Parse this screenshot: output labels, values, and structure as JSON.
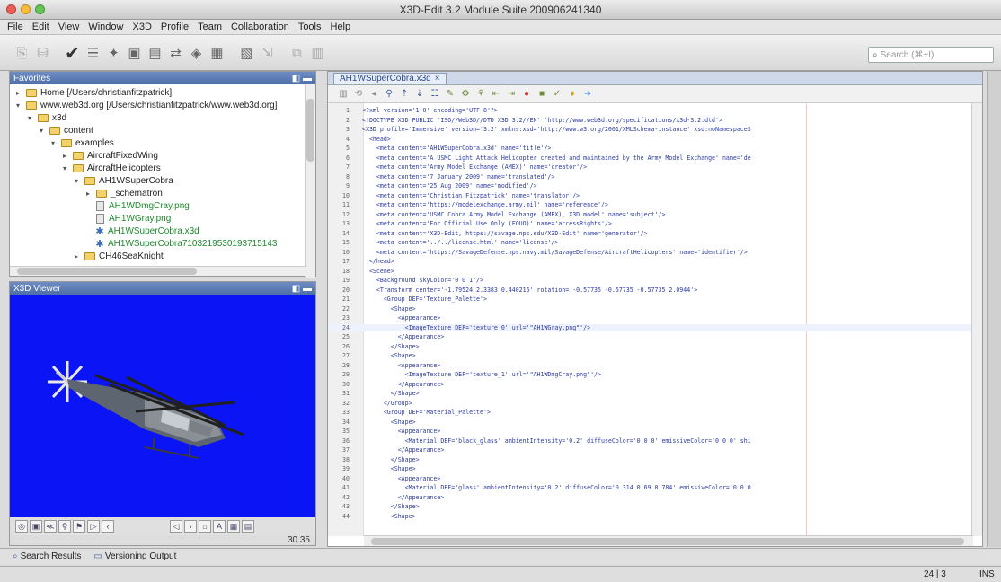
{
  "window": {
    "title": "X3D-Edit 3.2 Module Suite 200906241340"
  },
  "menu": [
    "File",
    "Edit",
    "View",
    "Window",
    "X3D",
    "Profile",
    "Team",
    "Collaboration",
    "Tools",
    "Help"
  ],
  "search": {
    "placeholder": "Search (⌘+I)"
  },
  "favorites": {
    "title": "Favorites",
    "items": [
      {
        "label": "Home [/Users/christianfitzpatrick]",
        "level": 0,
        "kind": "folder",
        "toggle": "+"
      },
      {
        "label": "www.web3d.org [/Users/christianfitzpatrick/www.web3d.org]",
        "level": 0,
        "kind": "folder",
        "toggle": "-"
      },
      {
        "label": "x3d",
        "level": 1,
        "kind": "folder",
        "toggle": "-"
      },
      {
        "label": "content",
        "level": 2,
        "kind": "folder",
        "toggle": "-"
      },
      {
        "label": "examples",
        "level": 3,
        "kind": "folder",
        "toggle": "-"
      },
      {
        "label": "AircraftFixedWing",
        "level": 4,
        "kind": "folder",
        "toggle": "+"
      },
      {
        "label": "AircraftHelicopters",
        "level": 4,
        "kind": "folder",
        "toggle": "-"
      },
      {
        "label": "AH1WSuperCobra",
        "level": 5,
        "kind": "folder",
        "toggle": "-"
      },
      {
        "label": "_schematron",
        "level": 6,
        "kind": "folder",
        "toggle": "+"
      },
      {
        "label": "AH1WDmgCray.png",
        "level": 6,
        "kind": "file",
        "toggle": ""
      },
      {
        "label": "AH1WGray.png",
        "level": 6,
        "kind": "file",
        "toggle": ""
      },
      {
        "label": "AH1WSuperCobra.x3d",
        "level": 6,
        "kind": "x3d",
        "toggle": ""
      },
      {
        "label": "AH1WSuperCobra7103219530193715143",
        "level": 6,
        "kind": "x3d",
        "toggle": ""
      },
      {
        "label": "CH46SeaKnight",
        "level": 5,
        "kind": "folder",
        "toggle": "+"
      }
    ]
  },
  "viewer": {
    "title": "X3D Viewer",
    "fps": "30.35"
  },
  "editor": {
    "tab": "AH1WSuperCobra.x3d",
    "lines": [
      {
        "n": "1",
        "t": "<?xml version='1.0' encoding='UTF-8'?>"
      },
      {
        "n": "2",
        "t": "<!DOCTYPE X3D PUBLIC 'ISO//Web3D//DTD X3D 3.2//EN' 'http://www.web3d.org/specifications/x3d-3.2.dtd'>"
      },
      {
        "n": "3",
        "t": "<X3D profile='Immersive' version='3.2' xmlns:xsd='http://www.w3.org/2001/XMLSchema-instance' xsd:noNamespaceS"
      },
      {
        "n": "4",
        "t": "  <head>"
      },
      {
        "n": "5",
        "t": "    <meta content='AH1WSuperCobra.x3d' name='title'/>"
      },
      {
        "n": "6",
        "t": "    <meta content='A USMC Light Attack Helicopter created and maintained by the Army Model Exchange' name='de"
      },
      {
        "n": "7",
        "t": "    <meta content='Army Model Exchange (AMEX)' name='creator'/>"
      },
      {
        "n": "8",
        "t": "    <meta content='7 January 2009' name='translated'/>"
      },
      {
        "n": "9",
        "t": "    <meta content='25 Aug 2009' name='modified'/>"
      },
      {
        "n": "10",
        "t": "    <meta content='Christian Fitzpatrick' name='translator'/>"
      },
      {
        "n": "11",
        "t": "    <meta content='https://modelexchange.army.mil' name='reference'/>"
      },
      {
        "n": "12",
        "t": "    <meta content='USMC Cobra Army Model Exchange (AMEX), X3D model' name='subject'/>"
      },
      {
        "n": "13",
        "t": "    <meta content='For Official Use Only (FOUO)' name='accessRights'/>"
      },
      {
        "n": "14",
        "t": "    <meta content='X3D-Edit, https://savage.nps.edu/X3D-Edit' name='generator'/>"
      },
      {
        "n": "15",
        "t": "    <meta content='../../license.html' name='license'/>"
      },
      {
        "n": "16",
        "t": "    <meta content='https://SavageDefense.nps.navy.mil/SavageDefense/AircraftHelicopters' name='identifier'/>"
      },
      {
        "n": "17",
        "t": "  </head>"
      },
      {
        "n": "18",
        "t": "  <Scene>"
      },
      {
        "n": "19",
        "t": "    <Background skyColor='0 0 1'/>"
      },
      {
        "n": "20",
        "t": "    <Transform center='-1.79524 2.3383 0.440216' rotation='-0.57735 -0.57735 -0.57735 2.0944'>"
      },
      {
        "n": "21",
        "t": "      <Group DEF='Texture_Palette'>"
      },
      {
        "n": "22",
        "t": "        <Shape>"
      },
      {
        "n": "23",
        "t": "          <Appearance>"
      },
      {
        "n": "24",
        "t": "            <ImageTexture DEF='texture_0' url='\"AH1WGray.png\"'/>"
      },
      {
        "n": "25",
        "t": "          </Appearance>"
      },
      {
        "n": "26",
        "t": "        </Shape>"
      },
      {
        "n": "27",
        "t": "        <Shape>"
      },
      {
        "n": "28",
        "t": "          <Appearance>"
      },
      {
        "n": "29",
        "t": "            <ImageTexture DEF='texture_1' url='\"AH1WDmgCray.png\"'/>"
      },
      {
        "n": "30",
        "t": "          </Appearance>"
      },
      {
        "n": "31",
        "t": "        </Shape>"
      },
      {
        "n": "32",
        "t": "      </Group>"
      },
      {
        "n": "33",
        "t": "      <Group DEF='Material_Palette'>"
      },
      {
        "n": "34",
        "t": "        <Shape>"
      },
      {
        "n": "35",
        "t": "          <Appearance>"
      },
      {
        "n": "36",
        "t": "            <Material DEF='black_glass' ambientIntensity='0.2' diffuseColor='0 0 0' emissiveColor='0 0 0' shi"
      },
      {
        "n": "37",
        "t": "          </Appearance>"
      },
      {
        "n": "38",
        "t": "        </Shape>"
      },
      {
        "n": "39",
        "t": "        <Shape>"
      },
      {
        "n": "40",
        "t": "          <Appearance>"
      },
      {
        "n": "41",
        "t": "            <Material DEF='glass' ambientIntensity='0.2' diffuseColor='0.314 0.69 0.784' emissiveColor='0 0 0"
      },
      {
        "n": "42",
        "t": "          </Appearance>"
      },
      {
        "n": "43",
        "t": "        </Shape>"
      },
      {
        "n": "44",
        "t": "        <Shape>"
      }
    ]
  },
  "bottom_tabs": [
    "Search Results",
    "Versioning Output"
  ],
  "status": {
    "position": "24 | 3",
    "mode": "INS"
  },
  "colors": {
    "viewport_bg": "#0b14f4",
    "accent": "#4f6fa8"
  }
}
